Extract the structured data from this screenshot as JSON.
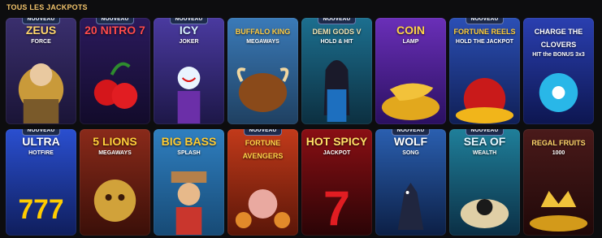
{
  "section": {
    "title": "TOUS LES JACKPOTS"
  },
  "badge_label": "NOUVEAU",
  "games": [
    {
      "title": "ZEUS",
      "subtitle": "FORCE",
      "new": true,
      "bg": [
        "#3a2f6e",
        "#1a1436"
      ],
      "title_color": "#ffd66b"
    },
    {
      "title": "20 NITRO 7",
      "subtitle": "",
      "new": true,
      "bg": [
        "#2b1a5c",
        "#120b2a"
      ],
      "title_color": "#ff4b4b"
    },
    {
      "title": "ICY",
      "subtitle": "JOKER",
      "new": true,
      "bg": [
        "#4a3aa0",
        "#1d1747"
      ],
      "title_color": "#d9f3ff"
    },
    {
      "title": "BUFFALO KING",
      "subtitle": "MEGAWAYS",
      "new": false,
      "bg": [
        "#3a7ab8",
        "#1f4061"
      ],
      "title_color": "#ffcc44"
    },
    {
      "title": "DEMI GODS V",
      "subtitle": "HOLD & HIT",
      "new": true,
      "bg": [
        "#1c6f8f",
        "#0c2f40"
      ],
      "title_color": "#f2e3b2"
    },
    {
      "title": "COIN",
      "subtitle": "LAMP",
      "new": false,
      "bg": [
        "#6a2fb8",
        "#2a1060"
      ],
      "title_color": "#ffd34a"
    },
    {
      "title": "FORTUNE REELS",
      "subtitle": "HOLD THE JACKPOT",
      "new": true,
      "bg": [
        "#2b4fb5",
        "#101f55"
      ],
      "title_color": "#ffcf3a"
    },
    {
      "title": "CHARGE THE CLOVERS",
      "subtitle": "HIT the BONUS 3x3",
      "new": false,
      "bg": [
        "#2a3fb0",
        "#0d1650"
      ],
      "title_color": "#ffffff"
    },
    {
      "title": "ULTRA",
      "subtitle": "HOTFIRE",
      "new": true,
      "bg": [
        "#2a4fd0",
        "#0f1e5c"
      ],
      "title_color": "#ffffff"
    },
    {
      "title": "5 LIONS",
      "subtitle": "MEGAWAYS",
      "new": false,
      "bg": [
        "#8a2a1a",
        "#3a0f08"
      ],
      "title_color": "#ffcf3a"
    },
    {
      "title": "BIG BASS",
      "subtitle": "SPLASH",
      "new": false,
      "bg": [
        "#2f7fc0",
        "#174a75"
      ],
      "title_color": "#ffcc33"
    },
    {
      "title": "FORTUNE AVENGERS",
      "subtitle": "",
      "new": true,
      "bg": [
        "#c23a1a",
        "#5a1608"
      ],
      "title_color": "#ffd44a"
    },
    {
      "title": "HOT SPICY",
      "subtitle": "JACKPOT",
      "new": false,
      "bg": [
        "#8a0f14",
        "#2a0406"
      ],
      "title_color": "#ffe066"
    },
    {
      "title": "WOLF",
      "subtitle": "SONG",
      "new": true,
      "bg": [
        "#2a5fb0",
        "#0c1f45"
      ],
      "title_color": "#ffffff"
    },
    {
      "title": "SEA OF",
      "subtitle": "WEALTH",
      "new": true,
      "bg": [
        "#1f7f9a",
        "#0b2f45"
      ],
      "title_color": "#e6f7ff"
    },
    {
      "title": "REGAL FRUITS",
      "subtitle": "1000",
      "new": false,
      "bg": [
        "#4a1a1a",
        "#1f0808"
      ],
      "title_color": "#ffd66b"
    }
  ]
}
